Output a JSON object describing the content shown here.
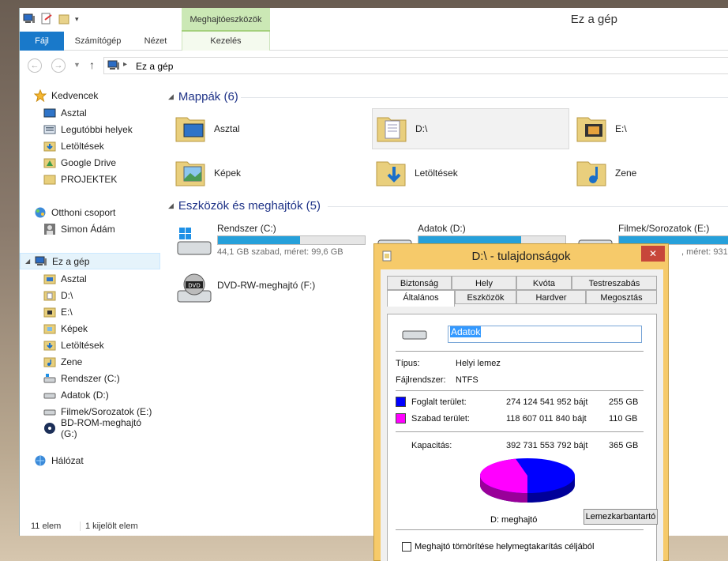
{
  "window": {
    "title": "Ez a gép",
    "context_tab": "Meghajtóeszközök"
  },
  "ribbon": {
    "tabs": [
      "Fájl",
      "Számítógép",
      "Nézet",
      "Kezelés"
    ]
  },
  "address": {
    "path": "Ez a gép"
  },
  "nav": {
    "favorites": "Kedvencek",
    "fav_items": [
      "Asztal",
      "Legutóbbi helyek",
      "Letöltések",
      "Google Drive",
      "PROJEKTEK"
    ],
    "homegroup": "Otthoni csoport",
    "user": "Simon Ádám",
    "this_pc": "Ez a gép",
    "pc_items": [
      "Asztal",
      "D:\\",
      "E:\\",
      "Képek",
      "Letöltések",
      "Zene",
      "Rendszer (C:)",
      "Adatok (D:)",
      "Filmek/Sorozatok (E:)",
      "BD-ROM-meghajtó (G:)"
    ],
    "network": "Hálózat"
  },
  "content": {
    "folders_header": "Mappák (6)",
    "folders": [
      "Asztal",
      "D:\\",
      "E:\\",
      "Képek",
      "Letöltések",
      "Zene"
    ],
    "devices_header": "Eszközök és meghajtók (5)",
    "drives": [
      {
        "name": "Rendszer (C:)",
        "free_text": "44,1 GB szabad, méret: 99,6 GB",
        "used_fraction": 0.56
      },
      {
        "name": "Adatok (D:)",
        "free_text": "",
        "used_fraction": 0.7
      },
      {
        "name": "Filmek/Sorozatok (E:)",
        "free_text": ", méret: 931",
        "used_fraction": 0.8
      }
    ],
    "dvd": "DVD-RW-meghajtó (F:)"
  },
  "status": {
    "count": "11 elem",
    "selected": "1 kijelölt elem"
  },
  "dialog": {
    "title": "D:\\ - tulajdonságok",
    "close": "✕",
    "tabs_top": [
      "Biztonság",
      "Hely",
      "Kvóta",
      "Testreszabás"
    ],
    "tabs_bottom": [
      "Általános",
      "Eszközök",
      "Hardver",
      "Megosztás"
    ],
    "drive_name": "Adatok",
    "type_label": "Típus:",
    "type_value": "Helyi lemez",
    "fs_label": "Fájlrendszer:",
    "fs_value": "NTFS",
    "used_label": "Foglalt terület:",
    "used_bytes": "274 124 541 952 bájt",
    "used_gb": "255 GB",
    "free_label": "Szabad terület:",
    "free_bytes": "118 607 011 840 bájt",
    "free_gb": "110 GB",
    "cap_label": "Kapacitás:",
    "cap_bytes": "392 731 553 792 bájt",
    "cap_gb": "365 GB",
    "drive_label": "D: meghajtó",
    "cleanup_button": "Lemezkarbantartó",
    "compress_label": "Meghajtó tömörítése helymegtakarítás céljából",
    "used_color": "#0000ff",
    "free_color": "#ff00ff"
  }
}
